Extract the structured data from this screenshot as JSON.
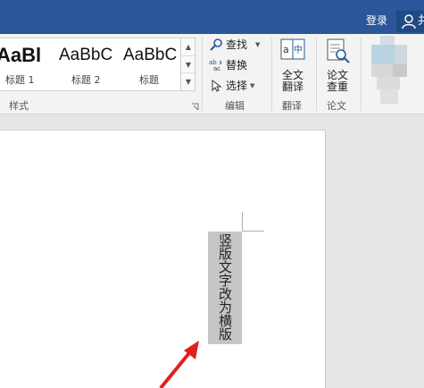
{
  "titlebar": {
    "login_label": "登录",
    "user_label": "共"
  },
  "ribbon": {
    "styles": {
      "items": [
        {
          "preview": "AaBl",
          "label": "标题 1"
        },
        {
          "preview": "AaBbC",
          "label": "标题 2"
        },
        {
          "preview": "AaBbC",
          "label": "标题"
        }
      ],
      "group_label": "样式"
    },
    "editing": {
      "find_label": "查找",
      "replace_label": "替换",
      "select_label": "选择",
      "group_label": "编辑"
    },
    "translate": {
      "button_label_line1": "全文",
      "button_label_line2": "翻译",
      "group_label": "翻译"
    },
    "paper": {
      "button_label_line1": "论文",
      "button_label_line2": "查重",
      "group_label": "论文"
    }
  },
  "document": {
    "selected_text": "竖版文字改为横版"
  },
  "colors": {
    "titlebar": "#2b579a",
    "arrow": "#e02020",
    "selection": "#c6c6c6"
  }
}
